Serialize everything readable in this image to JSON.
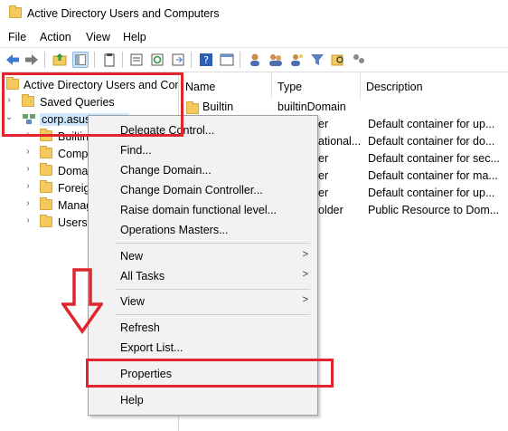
{
  "window": {
    "title": "Active Directory Users and Computers",
    "icon": "folder-icon"
  },
  "menu": [
    "File",
    "Action",
    "View",
    "Help"
  ],
  "toolbar_icons": [
    "back-arrow-icon",
    "forward-arrow-icon",
    "up-folder-icon",
    "show-hide-console-tree-icon",
    "clipboard-icon",
    "properties-icon",
    "refresh-icon",
    "export-list-icon",
    "help-icon",
    "console-icon",
    "user-icon",
    "users-icon",
    "filter-icon",
    "find-icon",
    "delegate-icon"
  ],
  "tree": {
    "root": "Active Directory Users and Com",
    "saved_queries": "Saved Queries",
    "domain": "corp.asustor.com",
    "children": [
      "Builtin",
      "Computers",
      "Domain",
      "Foreign",
      "Managed",
      "Users"
    ]
  },
  "list": {
    "columns": [
      "Name",
      "Type",
      "Description"
    ],
    "rows": [
      {
        "name": "Builtin",
        "type": "builtinDomain",
        "description": ""
      },
      {
        "name": "",
        "type": "er",
        "description": "Default container for up..."
      },
      {
        "name": "",
        "type": "ational...",
        "description": "Default container for do..."
      },
      {
        "name": "",
        "type": "er",
        "description": "Default container for sec..."
      },
      {
        "name": "",
        "type": "er",
        "description": "Default container for ma..."
      },
      {
        "name": "",
        "type": "er",
        "description": "Default container for up..."
      },
      {
        "name": "",
        "type": "older",
        "description": "Public Resource to Dom..."
      }
    ]
  },
  "context_menu": {
    "items": [
      {
        "label": "Delegate Control...",
        "submenu": false
      },
      {
        "label": "Find...",
        "submenu": false
      },
      {
        "label": "Change Domain...",
        "submenu": false
      },
      {
        "label": "Change Domain Controller...",
        "submenu": false
      },
      {
        "label": "Raise domain functional level...",
        "submenu": false
      },
      {
        "label": "Operations Masters...",
        "submenu": false
      },
      {
        "label": "New",
        "submenu": true
      },
      {
        "label": "All Tasks",
        "submenu": true
      },
      {
        "label": "View",
        "submenu": true
      },
      {
        "label": "Refresh",
        "submenu": false
      },
      {
        "label": "Export List...",
        "submenu": false
      },
      {
        "label": "Properties",
        "submenu": false
      },
      {
        "label": "Help",
        "submenu": false
      }
    ],
    "submenu_arrow": ">"
  },
  "annotation_color": "#e1252f"
}
